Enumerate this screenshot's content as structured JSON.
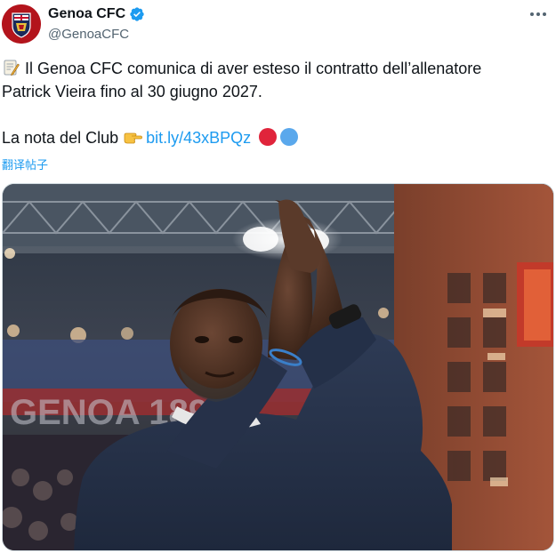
{
  "tweet": {
    "author": {
      "display_name": "Genoa CFC",
      "handle": "@GenoaCFC",
      "verified": true
    },
    "text_line_1": "Il Genoa CFC comunica di aver esteso il contratto dell’allenatore",
    "text_line_2": "Patrick Vieira fino al 30 giugno 2027.",
    "club_note_label": "La nota del Club",
    "link_text": "bit.ly/43xBPQz",
    "translate_label": "翻译帖子",
    "icons": {
      "leading": "memo-icon",
      "pointing": "pointing-right-icon",
      "club_colors": [
        "red-circle-icon",
        "blue-circle-icon"
      ],
      "menu": "more-options-icon"
    }
  },
  "colors": {
    "link": "#1d9bf0",
    "verified": "#1d9bf0",
    "secondary_text": "#536471",
    "club_red": "#e0243b",
    "club_blue": "#5aa8ec"
  }
}
